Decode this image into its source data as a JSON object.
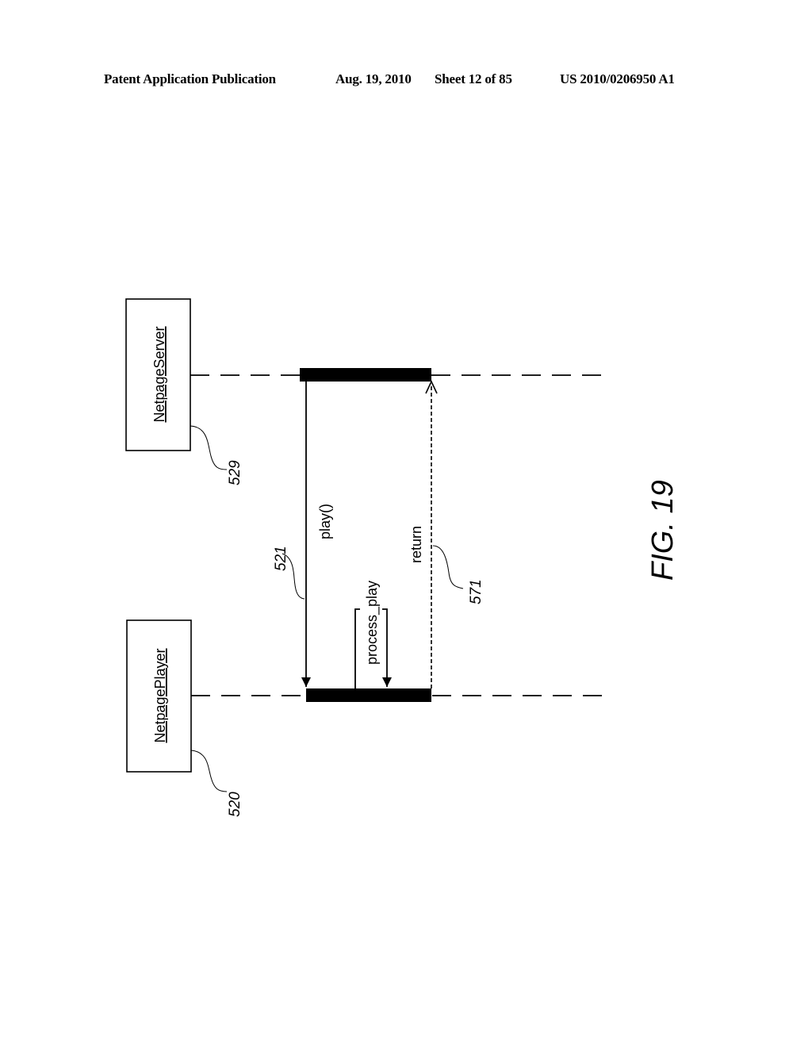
{
  "header": {
    "publication": "Patent Application Publication",
    "date": "Aug. 19, 2010",
    "sheet": "Sheet 12 of 85",
    "number": "US 2010/0206950 A1"
  },
  "figure": {
    "label": "FIG. 19",
    "objects": [
      {
        "name": "NetpageServer",
        "ref": "529"
      },
      {
        "name": "NetpagePlayer",
        "ref": "520"
      }
    ],
    "messages": [
      {
        "label": "play()",
        "ref": "521",
        "from": "NetpageServer",
        "to": "NetpagePlayer",
        "style": "solid"
      },
      {
        "label": "process_play",
        "ref": "",
        "from": "NetpagePlayer",
        "to": "NetpagePlayer",
        "style": "self"
      },
      {
        "label": "return",
        "ref": "571",
        "from": "NetpagePlayer",
        "to": "NetpageServer",
        "style": "dashed"
      }
    ]
  }
}
